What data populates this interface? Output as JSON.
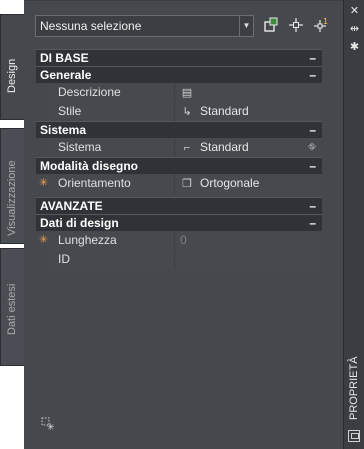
{
  "titlebar": {
    "title": "PROPRIETÀ",
    "close_icon": "✕",
    "autohide_icon": "⇹",
    "settings_icon": "✱"
  },
  "tabs": [
    {
      "label": "Design",
      "active": true
    },
    {
      "label": "Visualizzazione",
      "active": false
    },
    {
      "label": "Dati estesi",
      "active": false
    }
  ],
  "selector": {
    "value": "Nessuna selezione",
    "arrow": "▼"
  },
  "toolbar_icons": [
    "quick-select-icon",
    "select-objects-icon",
    "pickadd-toggle-icon"
  ],
  "categories": {
    "di_base": "DI BASE",
    "generale": "Generale",
    "sistema": "Sistema",
    "modalita": "Modalità disegno",
    "avanzate": "AVANZATE",
    "dati_design": "Dati di design",
    "collapse": "–"
  },
  "rows": {
    "descrizione": {
      "name": "Descrizione",
      "value": "",
      "icon": "▤"
    },
    "stile": {
      "name": "Stile",
      "value": "Standard",
      "icon": "↳"
    },
    "sistema": {
      "name": "Sistema",
      "value": "Standard",
      "icon": "⌐",
      "right_icon": "⛗"
    },
    "orientamento": {
      "name": "Orientamento",
      "value": "Ortogonale",
      "icon": "❒"
    },
    "lunghezza": {
      "name": "Lunghezza",
      "value": "0"
    },
    "id": {
      "name": "ID",
      "value": ""
    }
  },
  "star_glyph": "✳",
  "colors": {
    "panel_bg": "#45494e",
    "category_bg": "#2f3236",
    "accent_star": "#f0a050"
  }
}
